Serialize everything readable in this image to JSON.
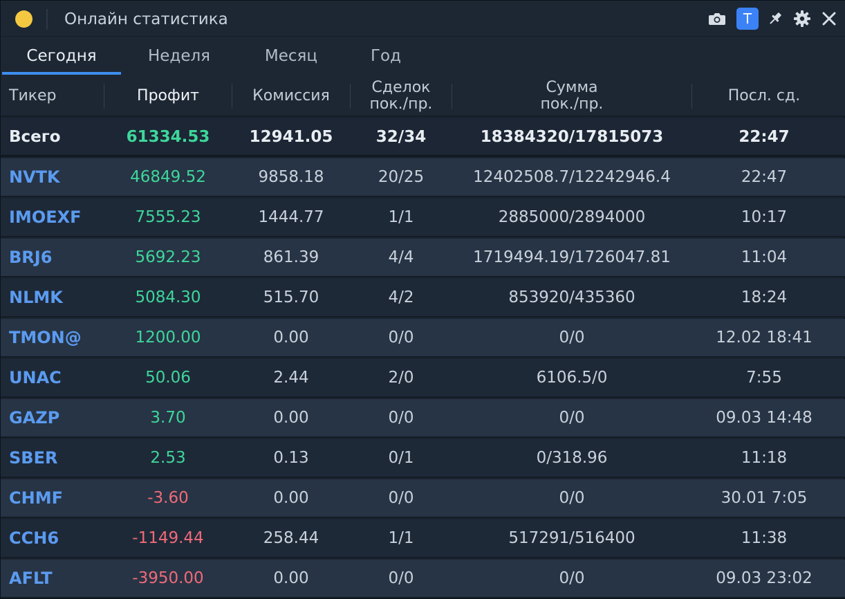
{
  "window": {
    "title": "Онлайн статистика",
    "t_button_label": "T",
    "status_color": "#f5c842",
    "accent_color": "#3d8ef0"
  },
  "tabs": [
    {
      "label": "Сегодня",
      "active": true
    },
    {
      "label": "Неделя",
      "active": false
    },
    {
      "label": "Месяц",
      "active": false
    },
    {
      "label": "Год",
      "active": false
    }
  ],
  "columns": {
    "ticker": "Тикер",
    "profit": "Профит",
    "commission": "Комиссия",
    "deals_line1": "Сделок",
    "deals_line2": "пок./пр.",
    "sum_line1": "Сумма",
    "sum_line2": "пок./пр.",
    "last_deal": "Посл. сд."
  },
  "total": {
    "ticker": "Всего",
    "profit": "61334.53",
    "commission": "12941.05",
    "deals": "32/34",
    "sum": "18384320/17815073",
    "last": "22:47"
  },
  "rows": [
    {
      "ticker": "NVTK",
      "profit": "46849.52",
      "commission": "9858.18",
      "deals": "20/25",
      "sum": "12402508.7/12242946.4",
      "last": "22:47"
    },
    {
      "ticker": "IMOEXF",
      "profit": "7555.23",
      "commission": "1444.77",
      "deals": "1/1",
      "sum": "2885000/2894000",
      "last": "10:17"
    },
    {
      "ticker": "BRJ6",
      "profit": "5692.23",
      "commission": "861.39",
      "deals": "4/4",
      "sum": "1719494.19/1726047.81",
      "last": "11:04"
    },
    {
      "ticker": "NLMK",
      "profit": "5084.30",
      "commission": "515.70",
      "deals": "4/2",
      "sum": "853920/435360",
      "last": "18:24"
    },
    {
      "ticker": "TMON@",
      "profit": "1200.00",
      "commission": "0.00",
      "deals": "0/0",
      "sum": "0/0",
      "last": "12.02 18:41"
    },
    {
      "ticker": "UNAC",
      "profit": "50.06",
      "commission": "2.44",
      "deals": "2/0",
      "sum": "6106.5/0",
      "last": "7:55"
    },
    {
      "ticker": "GAZP",
      "profit": "3.70",
      "commission": "0.00",
      "deals": "0/0",
      "sum": "0/0",
      "last": "09.03 14:48"
    },
    {
      "ticker": "SBER",
      "profit": "2.53",
      "commission": "0.13",
      "deals": "0/1",
      "sum": "0/318.96",
      "last": "11:18"
    },
    {
      "ticker": "CHMF",
      "profit": "-3.60",
      "commission": "0.00",
      "deals": "0/0",
      "sum": "0/0",
      "last": "30.01 7:05"
    },
    {
      "ticker": "CCH6",
      "profit": "-1149.44",
      "commission": "258.44",
      "deals": "1/1",
      "sum": "517291/516400",
      "last": "11:38"
    },
    {
      "ticker": "AFLT",
      "profit": "-3950.00",
      "commission": "0.00",
      "deals": "0/0",
      "sum": "0/0",
      "last": "09.03 23:02"
    }
  ]
}
